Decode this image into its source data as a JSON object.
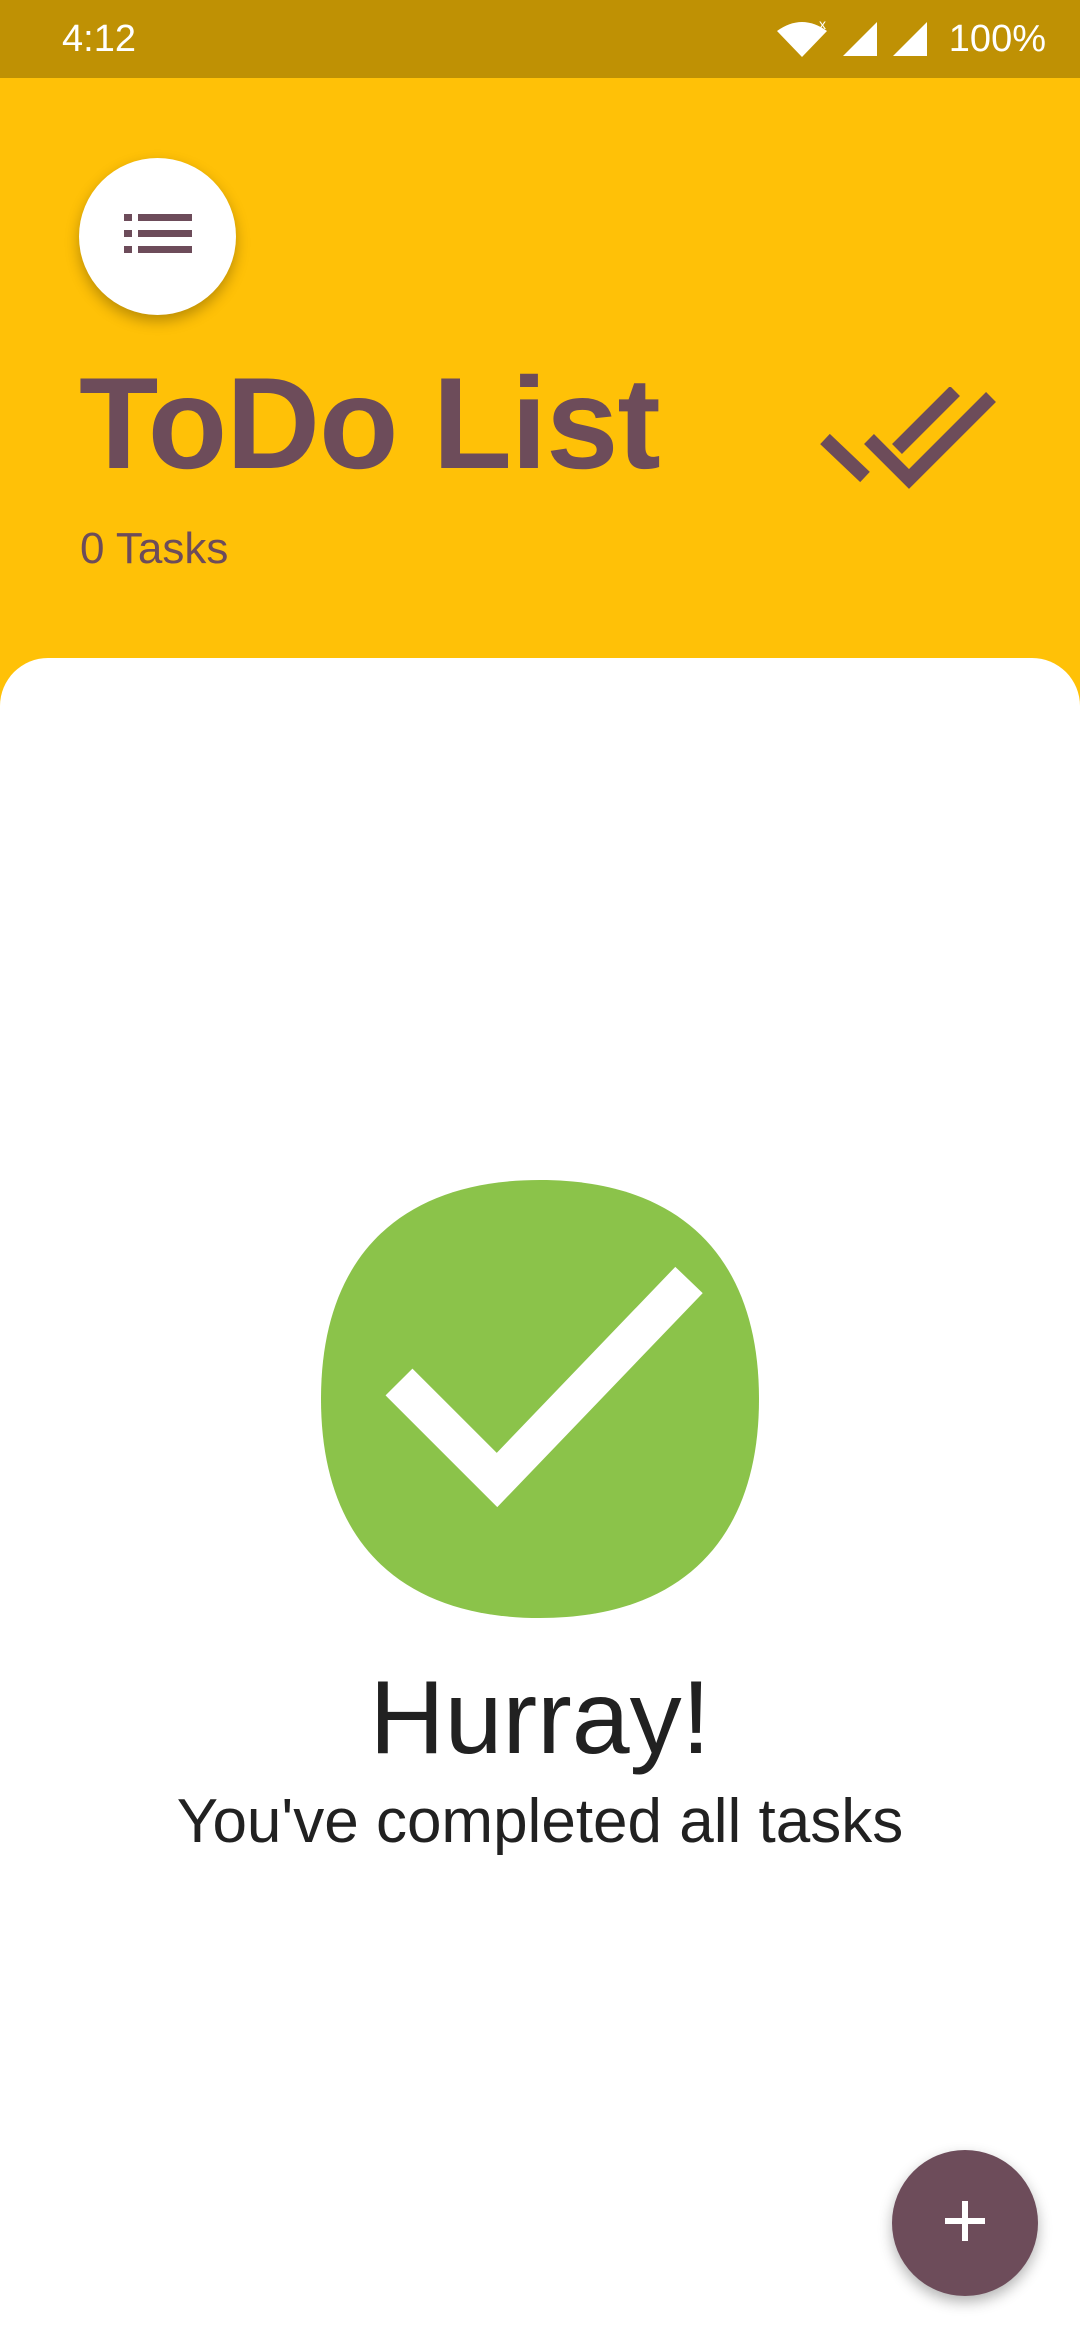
{
  "status_bar": {
    "time": "4:12",
    "battery": "100%",
    "icons": [
      "wifi-icon",
      "signal-icon",
      "signal-icon"
    ]
  },
  "header": {
    "menu_icon": "list-icon",
    "title": "ToDo List",
    "task_count": "0 Tasks",
    "done_all_icon": "done-all-icon"
  },
  "empty_state": {
    "icon": "check-circle-icon",
    "title": "Hurray!",
    "subtitle": "You've completed all tasks"
  },
  "fab": {
    "icon": "plus-icon"
  },
  "colors": {
    "status_bar": "#BF9104",
    "header": "#FFC107",
    "accent": "#6D4C5A",
    "success": "#8BC34A",
    "content_bg": "#FFFFFF"
  }
}
